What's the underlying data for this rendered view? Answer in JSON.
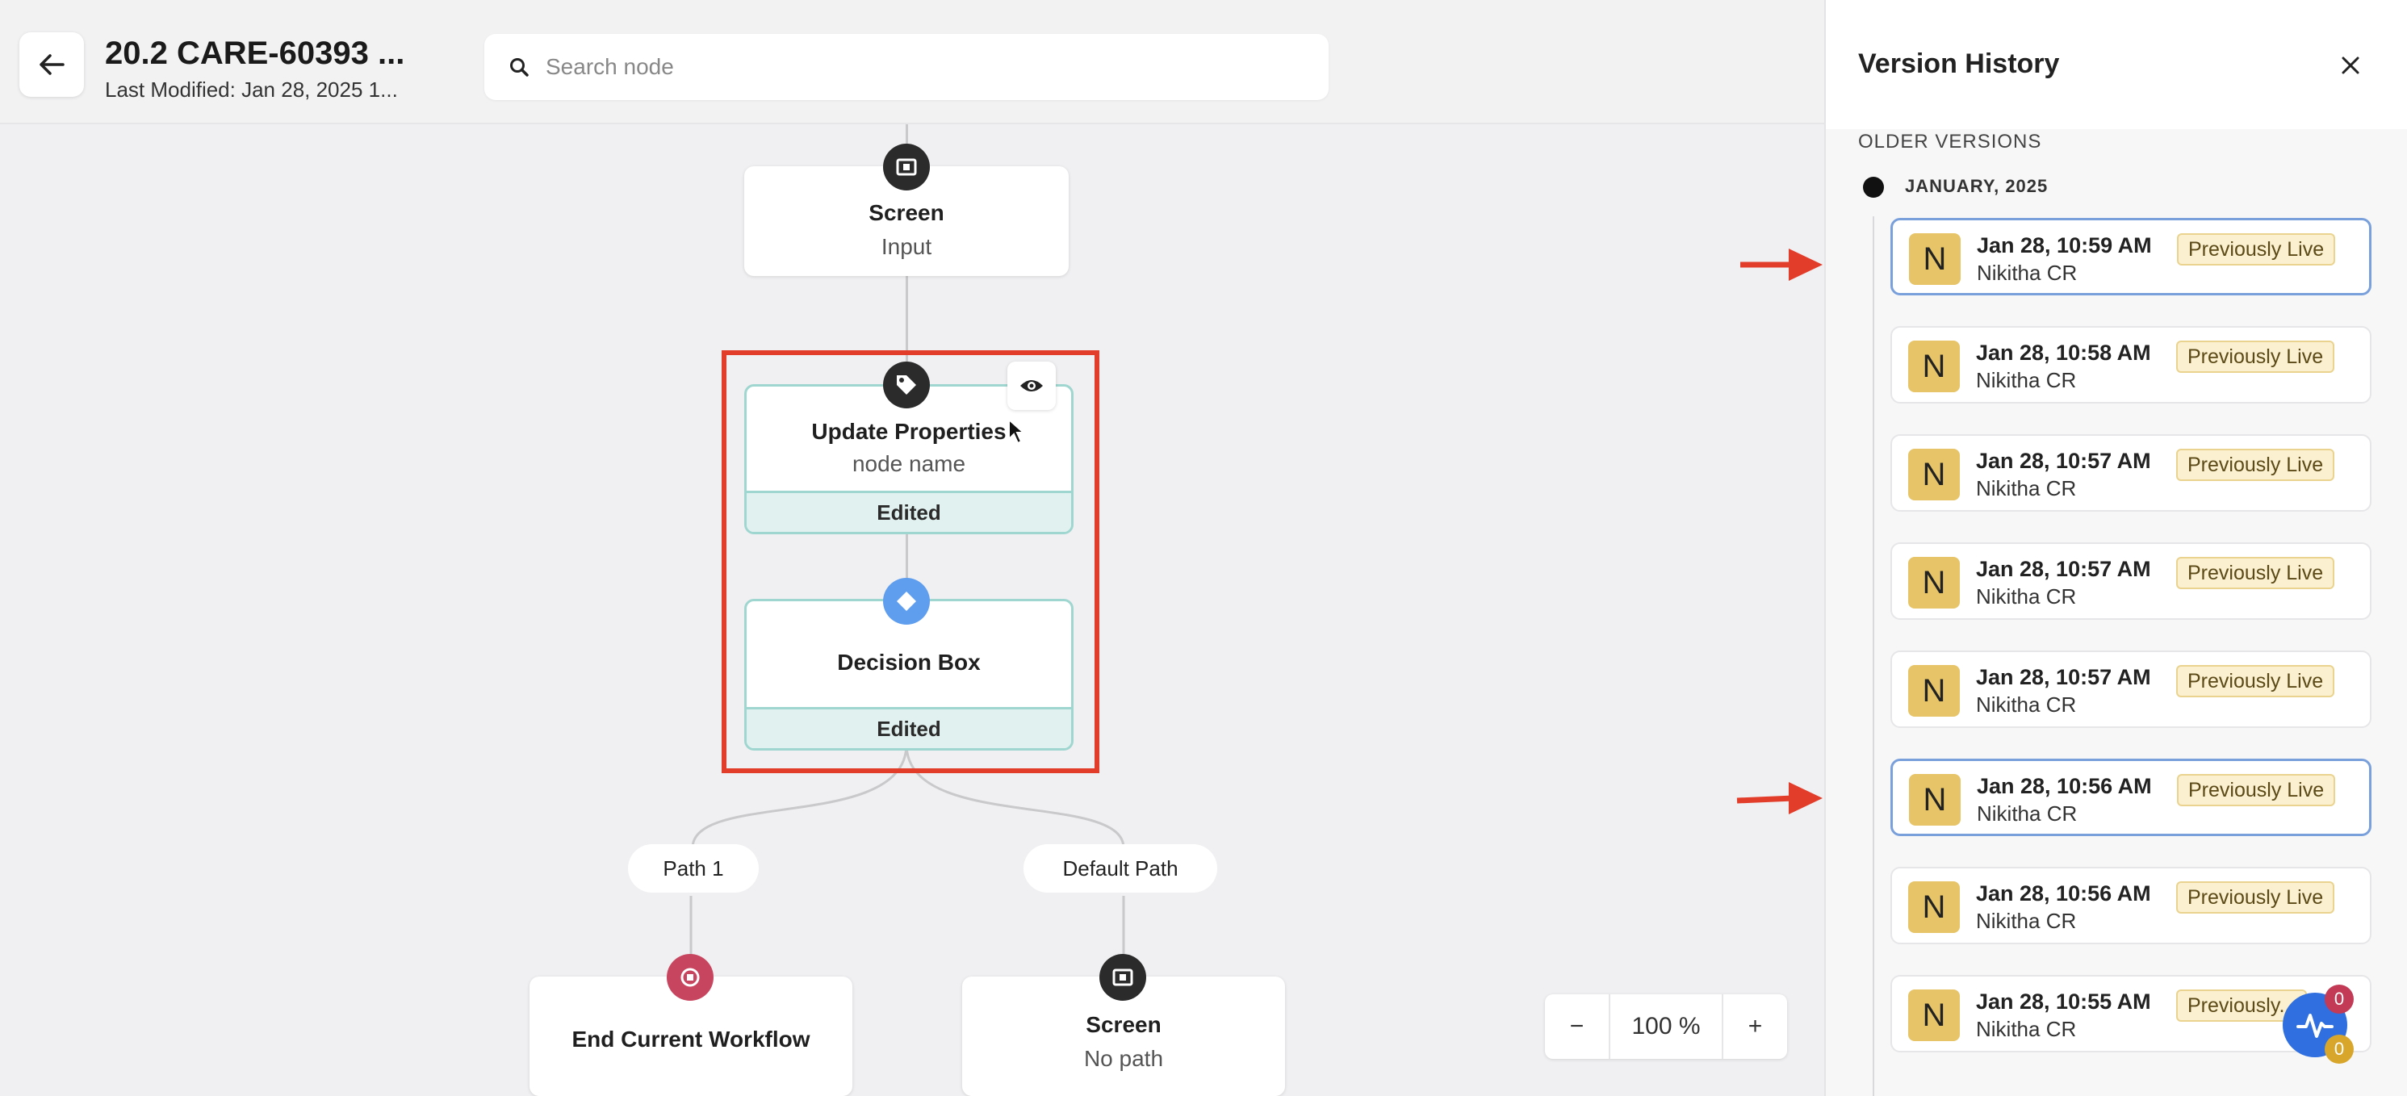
{
  "header": {
    "title": "20.2 CARE-60393 ...",
    "last_modified": "Last Modified: Jan 28, 2025 1...",
    "back_icon": "arrow-left-icon"
  },
  "search": {
    "placeholder": "Search node"
  },
  "flow": {
    "screen_top": {
      "title": "Screen",
      "subtitle": "Input",
      "icon": "screen-icon"
    },
    "update_properties": {
      "title": "Update Properties",
      "subtitle": "node name",
      "status": "Edited",
      "icon": "tag-icon"
    },
    "decision_box": {
      "title": "Decision Box",
      "status": "Edited",
      "icon": "diamond-icon"
    },
    "paths": [
      "Path 1",
      "Default Path"
    ],
    "end_workflow": {
      "title": "End Current Workflow",
      "icon": "stop-icon"
    },
    "screen_bottom": {
      "title": "Screen",
      "subtitle": "No path",
      "icon": "screen-icon"
    }
  },
  "zoom": {
    "minus": "−",
    "level": "100 %",
    "plus": "+"
  },
  "version_history": {
    "title": "Version History",
    "section_label": "OLDER VERSIONS",
    "month": "JANUARY, 2025",
    "versions": [
      {
        "avatar": "N",
        "time": "Jan 28, 10:59 AM",
        "user": "Nikitha CR",
        "badge": "Previously Live",
        "selected": true
      },
      {
        "avatar": "N",
        "time": "Jan 28, 10:58 AM",
        "user": "Nikitha CR",
        "badge": "Previously Live",
        "selected": false
      },
      {
        "avatar": "N",
        "time": "Jan 28, 10:57 AM",
        "user": "Nikitha CR",
        "badge": "Previously Live",
        "selected": false
      },
      {
        "avatar": "N",
        "time": "Jan 28, 10:57 AM",
        "user": "Nikitha CR",
        "badge": "Previously Live",
        "selected": false
      },
      {
        "avatar": "N",
        "time": "Jan 28, 10:57 AM",
        "user": "Nikitha CR",
        "badge": "Previously Live",
        "selected": false
      },
      {
        "avatar": "N",
        "time": "Jan 28, 10:56 AM",
        "user": "Nikitha CR",
        "badge": "Previously Live",
        "selected": true
      },
      {
        "avatar": "N",
        "time": "Jan 28, 10:56 AM",
        "user": "Nikitha CR",
        "badge": "Previously Live",
        "selected": false
      },
      {
        "avatar": "N",
        "time": "Jan 28, 10:55 AM",
        "user": "Nikitha CR",
        "badge": "Previously...",
        "selected": false
      }
    ]
  },
  "assistant": {
    "icon": "activity-icon",
    "badge_top": "0",
    "badge_bottom": "0"
  },
  "colors": {
    "annotation_red": "#e23d2b",
    "edited_teal": "#9fd6cf",
    "selected_border": "#7aa0dc",
    "badge_yellow": "#fbf0cf",
    "avatar_gold": "#e6c467"
  }
}
